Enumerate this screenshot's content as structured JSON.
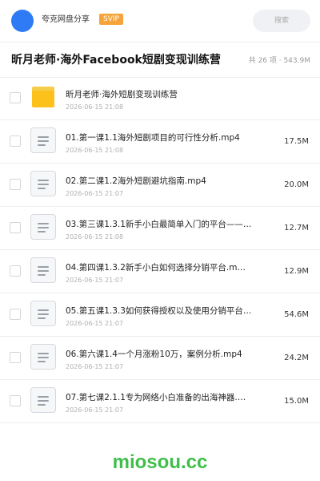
{
  "header": {
    "username": "夸克网盘分享",
    "badge": "SVIP",
    "search_label": "搜索"
  },
  "folder": {
    "title": "昕月老师·海外Facebook短剧变现训练营",
    "stats": "共 26 项 · 543.9M"
  },
  "files": [
    {
      "type": "folder",
      "name": "昕月老师·海外短剧变现训练营",
      "date": "2026-06-15 21:08",
      "size": ""
    },
    {
      "type": "file",
      "name": "01.第一课1.1海外短剧项目的可行性分析.mp4",
      "date": "2026-06-15 21:08",
      "size": "17.5M"
    },
    {
      "type": "file",
      "name": "02.第二课1.2海外短剧避坑指南.mp4",
      "date": "2026-06-15 21:07",
      "size": "20.0M"
    },
    {
      "type": "file",
      "name": "03.第三课1.3.1新手小白最简单入门的平台——…",
      "date": "2026-06-15 21:08",
      "size": "12.7M"
    },
    {
      "type": "file",
      "name": "04.第四课1.3.2新手小白如何选择分销平台.m…",
      "date": "2026-06-15 21:07",
      "size": "12.9M"
    },
    {
      "type": "file",
      "name": "05.第五课1.3.3如何获得授权以及使用分销平台…",
      "date": "2026-06-15 21:07",
      "size": "54.6M"
    },
    {
      "type": "file",
      "name": "06.第六课1.4一个月涨粉10万，案例分析.mp4",
      "date": "2026-06-15 21:07",
      "size": "24.2M"
    },
    {
      "type": "file",
      "name": "07.第七课2.1.1专为网络小白准备的出海神器.…",
      "date": "2026-06-15 21:07",
      "size": "15.0M"
    }
  ],
  "watermark": "miosou.cc",
  "colors": {
    "avatar": "#2f7bf5",
    "badge": "#f6a33a",
    "folder": "#fcc21b",
    "watermark": "#3fbf4a"
  },
  "icons": {
    "folder": "folder-icon",
    "file": "video-file-icon"
  }
}
